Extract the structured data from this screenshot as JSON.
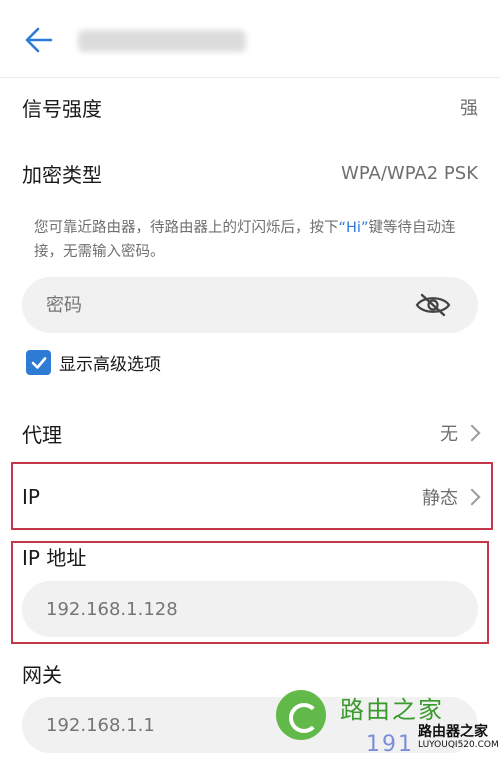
{
  "header": {
    "back_icon": "back-arrow-icon"
  },
  "rows": {
    "signal_label": "信号强度",
    "signal_value": "强",
    "security_label": "加密类型",
    "security_value": "WPA/WPA2 PSK"
  },
  "hint": {
    "part1": "您可靠近路由器，待路由器上的灯闪烁后，按下",
    "hi": "“Hi”",
    "part2": "键等待自动连接，无需输入密码。"
  },
  "password": {
    "placeholder": "密码",
    "toggle_icon": "eye-hidden-icon"
  },
  "advanced": {
    "label": "显示高级选项",
    "checked": true
  },
  "proxy": {
    "label": "代理",
    "value": "无"
  },
  "ip": {
    "label": "IP",
    "value": "静态"
  },
  "ip_address": {
    "label": "IP 地址",
    "value": "192.168.1.128"
  },
  "gateway": {
    "label": "网关",
    "value": "192.168.1.1"
  },
  "watermark": {
    "name_cn": "路由之家",
    "number": "191",
    "brand": "路由器之家",
    "url": "LUYOUQI520.COM"
  },
  "colors": {
    "accent": "#2e7bd6",
    "highlight_border": "#c4394a",
    "field_bg": "#f1f1f1"
  }
}
